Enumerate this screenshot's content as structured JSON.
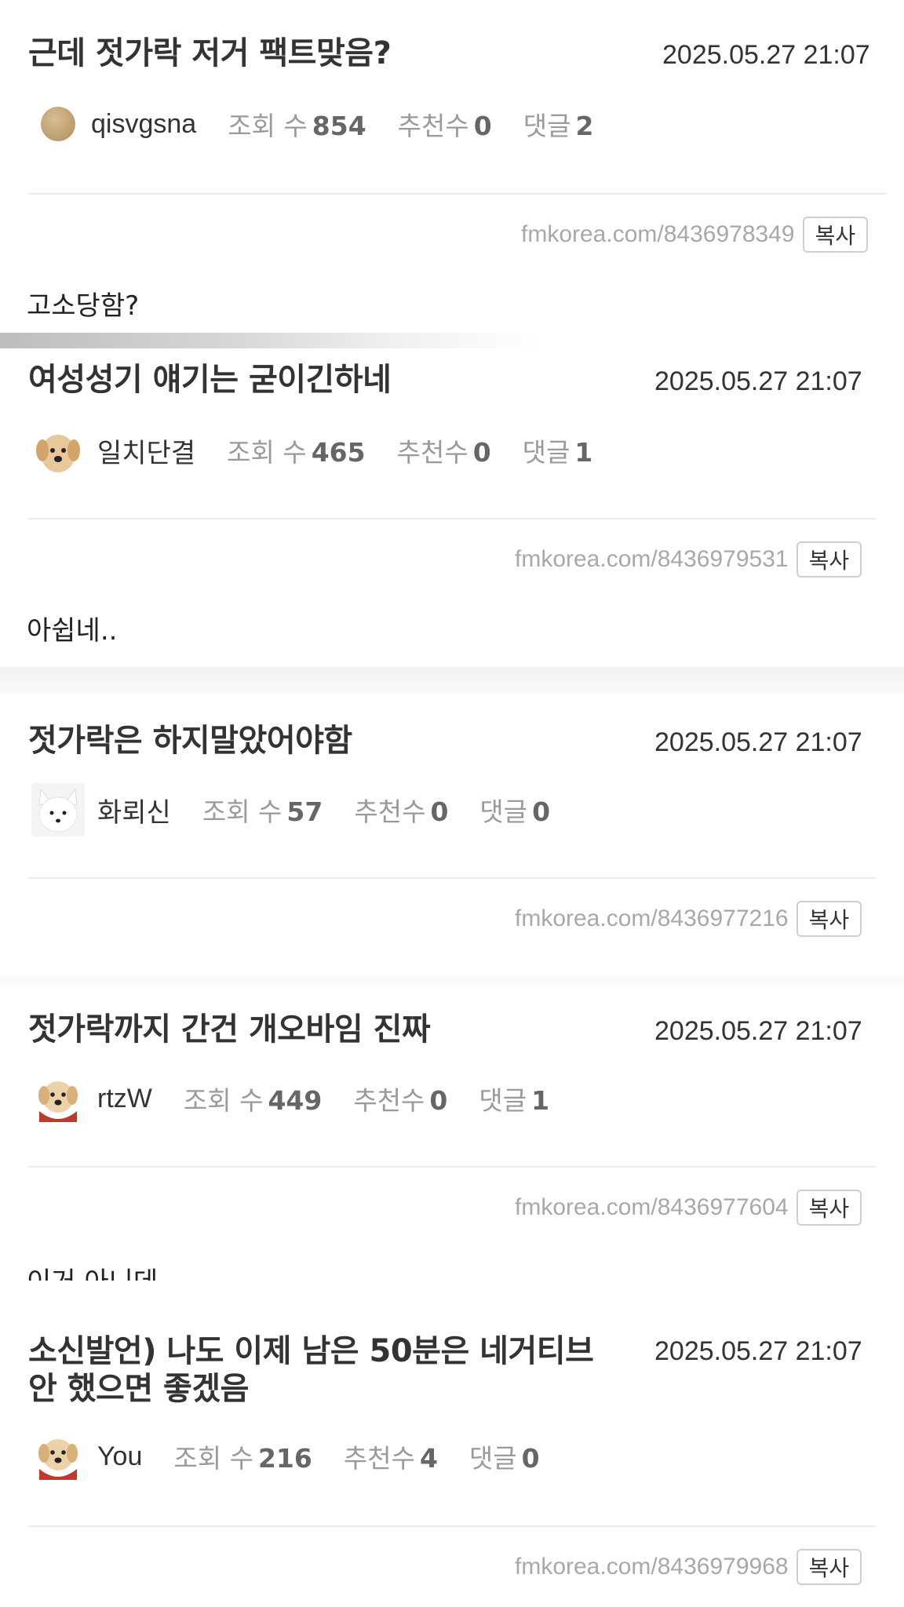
{
  "posts": [
    {
      "title": "근데 젓가락 저거 팩트맞음?",
      "date": "2025.05.27 21:07",
      "author": "qisvgsna",
      "views_label": "조회 수",
      "views": "854",
      "recs_label": "추천수",
      "recs": "0",
      "comments_label": "댓글",
      "comments": "2",
      "url": "fmkorea.com/8436978349",
      "copy_label": "복사",
      "body": "고소당함?"
    },
    {
      "title": "여성성기 얘기는 굳이긴하네",
      "date": "2025.05.27 21:07",
      "author": "일치단결",
      "views_label": "조회 수",
      "views": "465",
      "recs_label": "추천수",
      "recs": "0",
      "comments_label": "댓글",
      "comments": "1",
      "url": "fmkorea.com/8436979531",
      "copy_label": "복사",
      "body": "아쉽네.."
    },
    {
      "title": "젓가락은 하지말았어야함",
      "date": "2025.05.27 21:07",
      "author": "화뢰신",
      "views_label": "조회 수",
      "views": "57",
      "recs_label": "추천수",
      "recs": "0",
      "comments_label": "댓글",
      "comments": "0",
      "url": "fmkorea.com/8436977216",
      "copy_label": "복사"
    },
    {
      "title": "젓가락까지 간건 개오바임 진짜",
      "date": "2025.05.27 21:07",
      "author": "rtzW",
      "views_label": "조회 수",
      "views": "449",
      "recs_label": "추천수",
      "recs": "0",
      "comments_label": "댓글",
      "comments": "1",
      "url": "fmkorea.com/8436977604",
      "copy_label": "복사",
      "body": "이거 아니데"
    },
    {
      "title_line1": "소신발언) 나도 이제 남은 50분은 네거티브",
      "title_line2": "안 했으면 좋겠음",
      "date": "2025.05.27 21:07",
      "author": "You",
      "views_label": "조회 수",
      "views": "216",
      "recs_label": "추천수",
      "recs": "4",
      "comments_label": "댓글",
      "comments": "0",
      "url": "fmkorea.com/8436979968",
      "copy_label": "복사"
    }
  ],
  "colors": {
    "text": "#333333",
    "muted": "#9a9a9a",
    "divider": "#ececec",
    "url": "#a8a8a8"
  },
  "avatars": [
    "plain-tan-circle",
    "puppy-icon",
    "white-fox-icon",
    "puppy-red-cape-icon",
    "puppy-red-cape-icon"
  ]
}
